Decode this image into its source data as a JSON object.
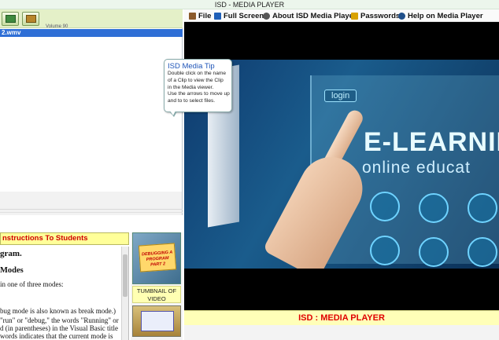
{
  "window": {
    "title": "ISD - MEDIA PLAYER"
  },
  "left_toolbar": {
    "small_label": "Volume   90"
  },
  "playlist": {
    "items": [
      {
        "label": "2.wmv"
      }
    ]
  },
  "instructions": {
    "header": "nstructions To Students",
    "heading": "gram.",
    "subheading": "Modes",
    "lines": [
      "in one of three modes:",
      "bug mode is also known as break mode.)",
      "\"run\" or \"debug,\" the words \"Running\" or",
      "d (in parentheses) in the Visual Basic title",
      "words indicates that the current mode is"
    ]
  },
  "thumbnails": {
    "card_text": "DEBUGGING A PROGRAM PART 2",
    "label": "TUMBNAIL OF VIDEO"
  },
  "menu": {
    "items": [
      {
        "label": "File",
        "icon": "file-icon",
        "color": "#8b5a2b"
      },
      {
        "label": "Full Screen",
        "icon": "full-screen-icon",
        "color": "#1f5fb8"
      },
      {
        "label": "About ISD Media Player",
        "icon": "about-icon",
        "color": "#555555"
      },
      {
        "label": "Passwords",
        "icon": "key-icon",
        "color": "#d9a200"
      },
      {
        "label": "Help on Media Player",
        "icon": "help-icon",
        "color": "#1f4f8a"
      }
    ]
  },
  "tip": {
    "title": "ISD Media Tip",
    "lines": [
      "Double click on the name",
      "of a Clip to view the Clip",
      "in the Media viewer.",
      "Use the arrows to move up",
      "and to to select files."
    ]
  },
  "video": {
    "login_text": "login",
    "headline": "E-LEARNING",
    "subline": "online educat"
  },
  "banner": {
    "text": "ISD : MEDIA PLAYER"
  }
}
